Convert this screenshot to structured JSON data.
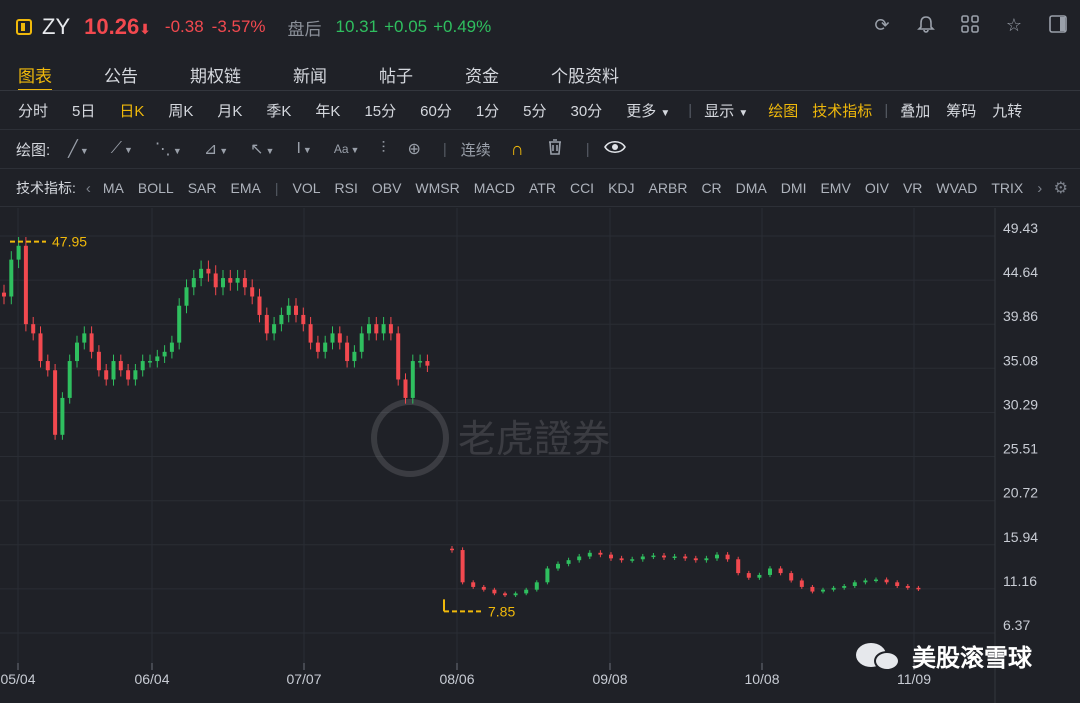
{
  "header": {
    "symbol": "ZY",
    "price": "10.26",
    "price_arrow": "⬇",
    "change": "-0.38",
    "change_pct": "-3.57%",
    "after_hours_label": "盘后",
    "after_hours_price": "10.31",
    "after_hours_change": "+0.05",
    "after_hours_pct": "+0.49%"
  },
  "tabs": [
    "图表",
    "公告",
    "期权链",
    "新闻",
    "帖子",
    "资金",
    "个股资料"
  ],
  "periods": {
    "items": [
      "分时",
      "5日",
      "日K",
      "周K",
      "月K",
      "季K",
      "年K",
      "15分",
      "60分",
      "1分",
      "5分",
      "30分"
    ],
    "more": "更多",
    "display": "显示",
    "draw": "绘图",
    "tech": "技术指标",
    "overlay": "叠加",
    "chips": "筹码",
    "nine": "九转"
  },
  "drawbar": {
    "label": "绘图:",
    "continuous": "连续"
  },
  "indicators": {
    "label": "技术指标:",
    "items": [
      "MA",
      "BOLL",
      "SAR",
      "EMA",
      "VOL",
      "RSI",
      "OBV",
      "WMSR",
      "MACD",
      "ATR",
      "CCI",
      "KDJ",
      "ARBR",
      "CR",
      "DMA",
      "DMI",
      "EMV",
      "OIV",
      "VR",
      "WVAD",
      "TRIX"
    ]
  },
  "watermark": "老虎證券",
  "brand": "美股滚雪球",
  "colors": {
    "up": "#2fbf5f",
    "down": "#f2494f",
    "accent": "#f0b90b",
    "bg": "#1f2127"
  },
  "chart_data": {
    "type": "candlestick",
    "yticks": [
      "49.43",
      "44.64",
      "39.86",
      "35.08",
      "30.29",
      "25.51",
      "20.72",
      "15.94",
      "11.16",
      "6.37"
    ],
    "xticks": [
      "05/04",
      "06/04",
      "07/07",
      "08/06",
      "09/08",
      "10/08",
      "11/09"
    ],
    "ylim": [
      6.37,
      49.43
    ],
    "high_marker": "47.95",
    "low_marker": "7.85",
    "series_segment_1": [
      42,
      46,
      47.5,
      39,
      38,
      35,
      34,
      27,
      31,
      35,
      37,
      38,
      36,
      34,
      33,
      35,
      34,
      33,
      34,
      35,
      35,
      35.5,
      36,
      37,
      41,
      43,
      44,
      45,
      44.5,
      43,
      44,
      43.5,
      44,
      43,
      42,
      40,
      38,
      39,
      40,
      41,
      40,
      39,
      37,
      36,
      37,
      38,
      37,
      35,
      36,
      38,
      39,
      38,
      39,
      38,
      33,
      31,
      35,
      35,
      34.5
    ],
    "series_segment_2": [
      14.5,
      11,
      10.5,
      10.2,
      9.8,
      9.6,
      9.8,
      10.2,
      11,
      12.5,
      13,
      13.4,
      13.8,
      14.2,
      14,
      13.6,
      13.4,
      13.5,
      13.8,
      13.9,
      13.7,
      13.8,
      13.6,
      13.4,
      13.6,
      14,
      13.5,
      12,
      11.5,
      11.8,
      12.5,
      12,
      11.2,
      10.5,
      10,
      10.2,
      10.4,
      10.6,
      11,
      11.2,
      11.3,
      11,
      10.6,
      10.4,
      10.26
    ]
  }
}
